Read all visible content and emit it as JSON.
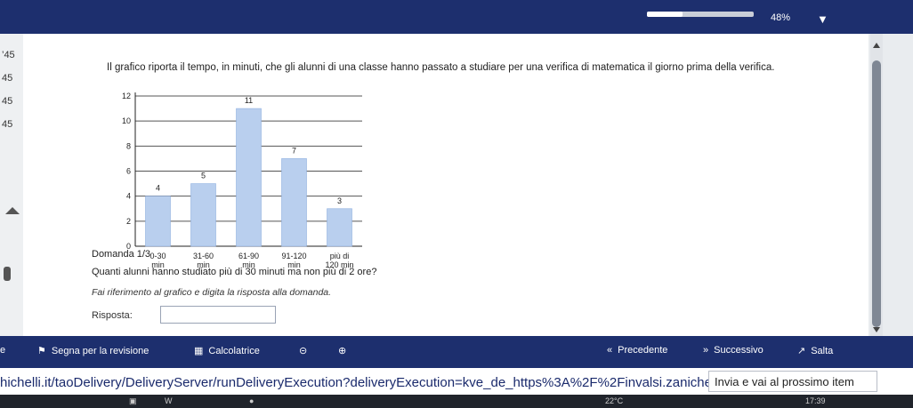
{
  "topbar": {
    "progress": 0.33,
    "percent": "48%",
    "wifi_icon": "wifi-icon"
  },
  "sidebar": {
    "times": [
      "45",
      "45",
      "45",
      "45"
    ],
    "partial_time": "’45"
  },
  "question": {
    "intro": "Il grafico riporta il tempo, in minuti, che gli alunni di una classe hanno passato a studiare per una verifica di matematica il giorno prima della verifica.",
    "number": "Domanda 1/3",
    "text": "Quanti alunni hanno studiato più di 30 minuti ma non più di 2 ore?",
    "hint": "Fai riferimento al grafico e digita la risposta alla domanda.",
    "answer_label": "Risposta:",
    "answer_value": ""
  },
  "chart_data": {
    "type": "bar",
    "categories": [
      [
        "0-30",
        "min"
      ],
      [
        "31-60",
        "min"
      ],
      [
        "61-90",
        "min"
      ],
      [
        "91-120",
        "min"
      ],
      [
        "più di",
        "120 min"
      ]
    ],
    "values": [
      4,
      5,
      11,
      7,
      3
    ],
    "data_labels": [
      "4",
      "5",
      "11",
      "7",
      "3"
    ],
    "ylim": [
      0,
      12
    ],
    "yticks": [
      "0",
      "2",
      "4",
      "6",
      "8",
      "10",
      "12"
    ],
    "grid": true,
    "bar_color": "#b9cfee"
  },
  "actions": {
    "review": "Segna per la revisione",
    "calculator": "Calcolatrice",
    "previous": "Precedente",
    "next": "Successivo",
    "skip": "Salta",
    "partial_left": "e"
  },
  "browser": {
    "url": "hichelli.it/taoDelivery/DeliveryServer/runDeliveryExecution?deliveryExecution=kve_de_https%3A%2F%2Finvalsi.zanichel",
    "status": "Invia e vai al prossimo item"
  },
  "taskbar": {
    "weather": "22°C",
    "time": "17:39"
  }
}
